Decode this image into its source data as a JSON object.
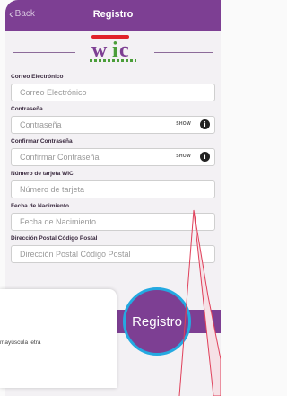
{
  "header": {
    "back_label": "Back",
    "title": "Registro"
  },
  "logo": {
    "text_w": "w",
    "text_i": "i",
    "text_c": "c"
  },
  "form": {
    "email": {
      "label": "Correo Electrónico",
      "placeholder": "Correo Electrónico"
    },
    "password": {
      "label": "Contraseña",
      "placeholder": "Contraseña",
      "show": "SHOW"
    },
    "confirm_password": {
      "label": "Confirmar Contraseña",
      "placeholder": "Confirmar Contraseña",
      "show": "SHOW"
    },
    "wic_card": {
      "label": "Número de tarjeta WIC",
      "placeholder": "Número de tarjeta"
    },
    "birth_date": {
      "label": "Fecha de Nacimiento",
      "placeholder": "Fecha de Nacimiento"
    },
    "postal_code": {
      "label": "Dirección Postal Código Postal",
      "placeholder": "Dirección Postal Código Postal"
    }
  },
  "popup": {
    "text": "mayúscula letra"
  },
  "register_button": "Registro",
  "colors": {
    "brand_purple": "#7d3f93",
    "highlight_blue": "#24a9e1",
    "pointer_red": "#e0405a"
  }
}
